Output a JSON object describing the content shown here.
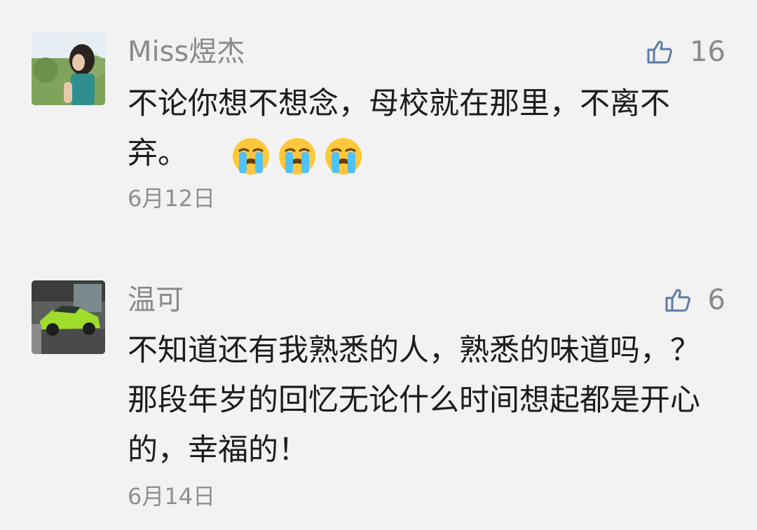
{
  "comments": [
    {
      "username": "Miss煜杰",
      "likes": "16",
      "text": "不论你想不想念，母校就在那里，不离不弃。",
      "emoji": [
        "crying-face",
        "crying-face",
        "crying-face"
      ],
      "date": "6月12日"
    },
    {
      "username": "温可",
      "likes": "6",
      "text": "不知道还有我熟悉的人，熟悉的味道吗，？那段年岁的回忆无论什么时间想起都是开心的，幸福的！",
      "date": "6月14日"
    }
  ],
  "colors": {
    "background": "#f2f2f2",
    "meta_text": "#8a8a8a",
    "body_text": "#1c1c1c",
    "like_icon": "#5b7aa6",
    "emoji_face": "#ffc83a",
    "emoji_tears": "#4fc3f7"
  },
  "icons": {
    "like": "thumbs-up-icon",
    "emoji": "crying-face-emoji"
  }
}
